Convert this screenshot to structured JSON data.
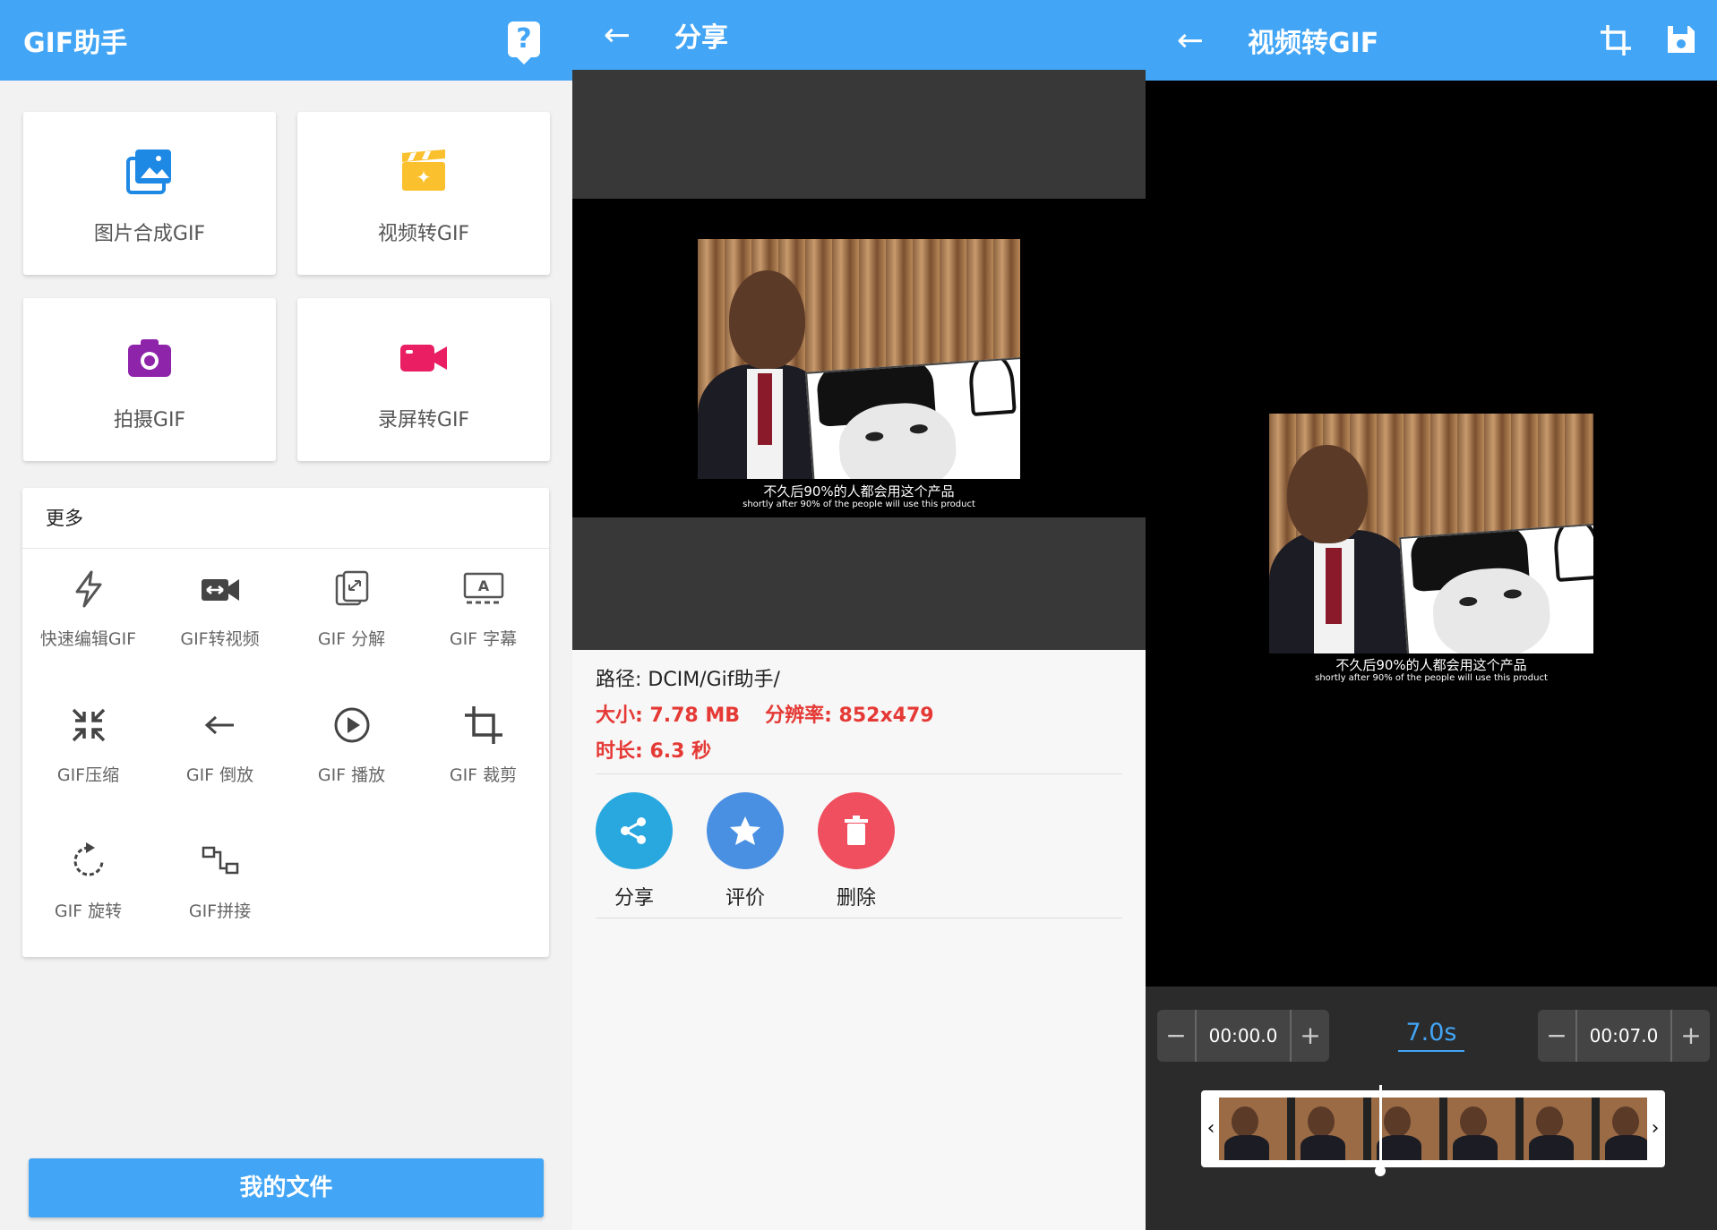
{
  "panel1": {
    "title": "GIF助手",
    "help_icon": "question-icon",
    "cards": [
      {
        "label": "图片合成GIF",
        "icon": "image-stack-icon",
        "color": "#1e88e5"
      },
      {
        "label": "视频转GIF",
        "icon": "clapperboard-sparkle-icon",
        "color": "#fbc02d"
      },
      {
        "label": "拍摄GIF",
        "icon": "camera-icon",
        "color": "#8e24aa"
      },
      {
        "label": "录屏转GIF",
        "icon": "video-camera-icon",
        "color": "#e91e63"
      }
    ],
    "more_title": "更多",
    "tools": [
      {
        "label": "快速编辑GIF",
        "icon": "lightning-icon"
      },
      {
        "label": "GIF转视频",
        "icon": "video-convert-icon"
      },
      {
        "label": "GIF 分解",
        "icon": "split-icon"
      },
      {
        "label": "GIF 字幕",
        "icon": "subtitle-icon"
      },
      {
        "label": "GIF压缩",
        "icon": "compress-icon"
      },
      {
        "label": "GIF 倒放",
        "icon": "reverse-arrow-icon"
      },
      {
        "label": "GIF 播放",
        "icon": "play-icon"
      },
      {
        "label": "GIF 裁剪",
        "icon": "crop-icon"
      },
      {
        "label": "GIF 旋转",
        "icon": "rotate-icon"
      },
      {
        "label": "GIF拼接",
        "icon": "join-icon"
      }
    ],
    "my_files": "我的文件"
  },
  "panel2": {
    "title": "分享",
    "subtitle_cn": "不久后90%的人都会用这个产品",
    "subtitle_en": "shortly after 90% of the people will use this product",
    "path": "路径: DCIM/Gif助手/",
    "size": "大小: 7.78 MB",
    "resolution": "分辨率: 852x479",
    "duration": "时长: 6.3 秒",
    "actions": [
      {
        "label": "分享",
        "icon": "share-icon",
        "color": "#29a8e0"
      },
      {
        "label": "评价",
        "icon": "star-icon",
        "color": "#4a90e2"
      },
      {
        "label": "删除",
        "icon": "trash-icon",
        "color": "#ef4f5f"
      }
    ]
  },
  "panel3": {
    "title": "视频转GIF",
    "subtitle_cn": "不久后90%的人都会用这个产品",
    "subtitle_en": "shortly after 90% of the people will use this product",
    "start_time": "00:00.0",
    "end_time": "00:07.0",
    "duration": "7.0s",
    "minus": "−",
    "plus": "+",
    "left_arrow": "‹",
    "right_arrow": "›"
  },
  "colors": {
    "accent": "#42a5f5",
    "danger": "#e53935"
  }
}
